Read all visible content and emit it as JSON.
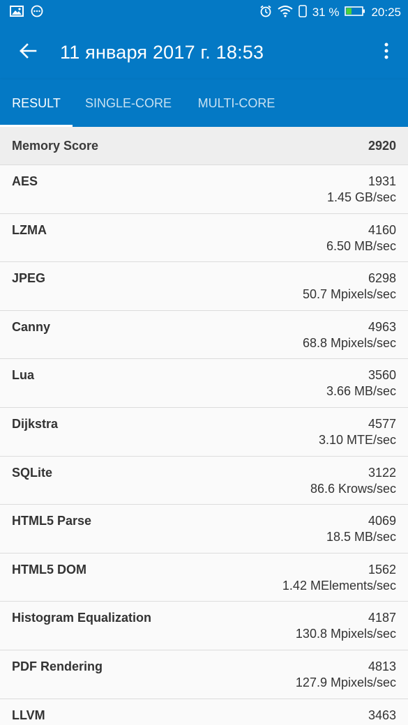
{
  "status_bar": {
    "battery_text": "31 %",
    "time": "20:25"
  },
  "app_bar": {
    "title": "11 января 2017 г. 18:53"
  },
  "tabs": [
    {
      "label": "RESULT",
      "active": true
    },
    {
      "label": "SINGLE-CORE",
      "active": false
    },
    {
      "label": "MULTI-CORE",
      "active": false
    }
  ],
  "section": {
    "title": "Memory Score",
    "score": "2920"
  },
  "rows": [
    {
      "name": "AES",
      "score": "1931",
      "rate": "1.45 GB/sec"
    },
    {
      "name": "LZMA",
      "score": "4160",
      "rate": "6.50 MB/sec"
    },
    {
      "name": "JPEG",
      "score": "6298",
      "rate": "50.7 Mpixels/sec"
    },
    {
      "name": "Canny",
      "score": "4963",
      "rate": "68.8 Mpixels/sec"
    },
    {
      "name": "Lua",
      "score": "3560",
      "rate": "3.66 MB/sec"
    },
    {
      "name": "Dijkstra",
      "score": "4577",
      "rate": "3.10 MTE/sec"
    },
    {
      "name": "SQLite",
      "score": "3122",
      "rate": "86.6 Krows/sec"
    },
    {
      "name": "HTML5 Parse",
      "score": "4069",
      "rate": "18.5 MB/sec"
    },
    {
      "name": "HTML5 DOM",
      "score": "1562",
      "rate": "1.42 MElements/sec"
    },
    {
      "name": "Histogram Equalization",
      "score": "4187",
      "rate": "130.8 Mpixels/sec"
    },
    {
      "name": "PDF Rendering",
      "score": "4813",
      "rate": "127.9 Mpixels/sec"
    },
    {
      "name": "LLVM",
      "score": "3463",
      "rate": ""
    }
  ],
  "colors": {
    "primary": "#0479c5",
    "header_bg": "#eeeeee",
    "battery_fill": "#4cd137"
  }
}
